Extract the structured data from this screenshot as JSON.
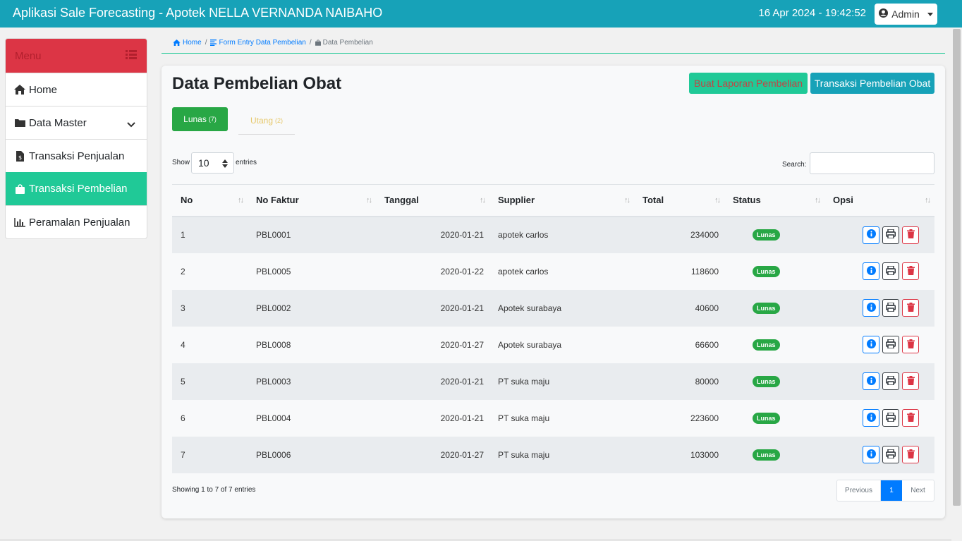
{
  "app": {
    "title": "Aplikasi Sale Forecasting - Apotek NELLA VERNANDA NAIBAHO",
    "datetime": "16 Apr 2024 -  19:42:52",
    "user_label": "Admin"
  },
  "sidebar": {
    "header": "Menu",
    "items": [
      {
        "label": "Home",
        "icon": "home-icon"
      },
      {
        "label": "Data Master",
        "icon": "folder-icon"
      },
      {
        "label": "Transaksi Penjualan",
        "icon": "file-invoice-icon"
      },
      {
        "label": "Transaksi Pembelian",
        "icon": "shopping-bag-icon",
        "active": true
      },
      {
        "label": "Peramalan Penjualan",
        "icon": "chart-bar-icon"
      }
    ]
  },
  "breadcrumb": {
    "home": "Home",
    "form": "Form Entry Data Pembelian",
    "current": "Data Pembelian"
  },
  "page": {
    "title": "Data Pembelian Obat",
    "report_button": "Buat Laporan Pembelian",
    "transaction_button": "Transaksi Pembelian Obat"
  },
  "tabs": {
    "lunas": {
      "label": "Lunas",
      "count": "7"
    },
    "utang": {
      "label": "Utang",
      "count": "2"
    }
  },
  "table_controls": {
    "show_label": "Show",
    "length_value": "10",
    "entries_label": "entries",
    "search_label": "Search:",
    "search_value": ""
  },
  "table": {
    "headers": [
      "No",
      "No Faktur",
      "Tanggal",
      "Supplier",
      "Total",
      "Status",
      "Opsi"
    ],
    "rows": [
      {
        "no": "1",
        "faktur": "PBL0001",
        "tanggal": "2020-01-21",
        "supplier": "apotek carlos",
        "total": "234000",
        "status": "Lunas"
      },
      {
        "no": "2",
        "faktur": "PBL0005",
        "tanggal": "2020-01-22",
        "supplier": "apotek carlos",
        "total": "118600",
        "status": "Lunas"
      },
      {
        "no": "3",
        "faktur": "PBL0002",
        "tanggal": "2020-01-21",
        "supplier": "Apotek surabaya",
        "total": "40600",
        "status": "Lunas"
      },
      {
        "no": "4",
        "faktur": "PBL0008",
        "tanggal": "2020-01-27",
        "supplier": "Apotek surabaya",
        "total": "66600",
        "status": "Lunas"
      },
      {
        "no": "5",
        "faktur": "PBL0003",
        "tanggal": "2020-01-21",
        "supplier": "PT suka maju",
        "total": "80000",
        "status": "Lunas"
      },
      {
        "no": "6",
        "faktur": "PBL0004",
        "tanggal": "2020-01-21",
        "supplier": "PT suka maju",
        "total": "223600",
        "status": "Lunas"
      },
      {
        "no": "7",
        "faktur": "PBL0006",
        "tanggal": "2020-01-27",
        "supplier": "PT suka maju",
        "total": "103000",
        "status": "Lunas"
      }
    ]
  },
  "footer": {
    "showing": "Showing 1 to 7 of 7 entries",
    "prev": "Previous",
    "page": "1",
    "next": "Next"
  },
  "colors": {
    "navbar": "#17a2b8",
    "active": "#20c997",
    "danger": "#dc3545",
    "success": "#28a745",
    "primary": "#007bff"
  }
}
